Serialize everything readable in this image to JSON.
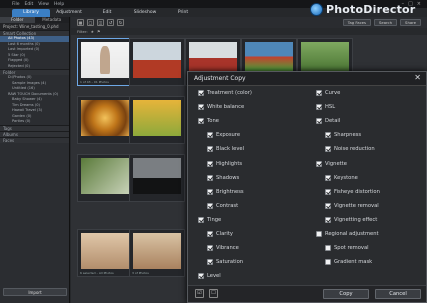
{
  "app": {
    "menu": [
      "File",
      "Edit",
      "View",
      "Help"
    ],
    "brand": "PhotoDirector",
    "tabs": [
      "Library",
      "Adjustment",
      "Edit",
      "Slideshow",
      "Print"
    ],
    "active_tab": "Library"
  },
  "left_panel": {
    "tabs": [
      "Folder",
      "Metadata"
    ],
    "project": "Project: Wine_tasting_0.phd",
    "sections": {
      "smart": "Smart Collection",
      "folder": "Folder",
      "tags": "Tags",
      "albums": "Albums",
      "faces": "Faces"
    },
    "smart_items": [
      "All Photos (43)",
      "Last 6 months (0)",
      "Last Imported (0)",
      "5 Star (0)",
      "Flagged (0)",
      "Rejected (0)"
    ],
    "folder_items": [
      "D:\\Photos (0)",
      "Sample Images (4)",
      "Untitled (16)",
      "RAW TOUCH Documents (0)",
      "Baby Shower (4)",
      "Tim Dreams (0)",
      "Hawaii Travel (3)",
      "Garden (0)",
      "Parties (0)"
    ],
    "import_label": "Import"
  },
  "main": {
    "toolbar_pills": [
      "Tag Faces",
      "Search",
      "Share"
    ],
    "filter_label": "Filter:",
    "captions": [
      "1 of 43 – 01 Photos",
      "",
      "",
      "",
      "",
      "",
      "",
      "",
      "",
      "6 selected – All Photos",
      "3 of Photos"
    ]
  },
  "dialog": {
    "title": "Adjustment Copy",
    "left_col": [
      {
        "label": "Treatment (color)",
        "checked": true,
        "indent": false
      },
      {
        "label": "White balance",
        "checked": true,
        "indent": false
      },
      {
        "label": "Tone",
        "checked": true,
        "indent": false
      },
      {
        "label": "Exposure",
        "checked": true,
        "indent": true
      },
      {
        "label": "Black level",
        "checked": true,
        "indent": true
      },
      {
        "label": "Highlights",
        "checked": true,
        "indent": true
      },
      {
        "label": "Shadows",
        "checked": true,
        "indent": true
      },
      {
        "label": "Brightness",
        "checked": true,
        "indent": true
      },
      {
        "label": "Contrast",
        "checked": true,
        "indent": true
      },
      {
        "label": "Tinge",
        "checked": true,
        "indent": false
      },
      {
        "label": "Clarity",
        "checked": true,
        "indent": true
      },
      {
        "label": "Vibrance",
        "checked": true,
        "indent": true
      },
      {
        "label": "Saturation",
        "checked": true,
        "indent": true
      },
      {
        "label": "Level",
        "checked": true,
        "indent": false
      }
    ],
    "right_col": [
      {
        "label": "Curve",
        "checked": true,
        "indent": false
      },
      {
        "label": "HSL",
        "checked": true,
        "indent": false
      },
      {
        "label": "Detail",
        "checked": true,
        "indent": false
      },
      {
        "label": "Sharpness",
        "checked": true,
        "indent": true
      },
      {
        "label": "Noise reduction",
        "checked": true,
        "indent": true
      },
      {
        "label": "Vignette",
        "checked": true,
        "indent": false
      },
      {
        "label": "Keystone",
        "checked": true,
        "indent": true
      },
      {
        "label": "Fisheye distortion",
        "checked": true,
        "indent": true
      },
      {
        "label": "Vignette removal",
        "checked": true,
        "indent": true
      },
      {
        "label": "Vignetting effect",
        "checked": true,
        "indent": true
      },
      {
        "label": "Regional adjustment",
        "checked": false,
        "indent": false
      },
      {
        "label": "Spot removal",
        "checked": false,
        "indent": true
      },
      {
        "label": "Gradient mask",
        "checked": false,
        "indent": true
      }
    ],
    "copy_label": "Copy",
    "cancel_label": "Cancel",
    "colors": {
      "accent": "#3b7fc4",
      "dialog_bg": "#2a2c2f",
      "title_bg": "#202124"
    }
  }
}
